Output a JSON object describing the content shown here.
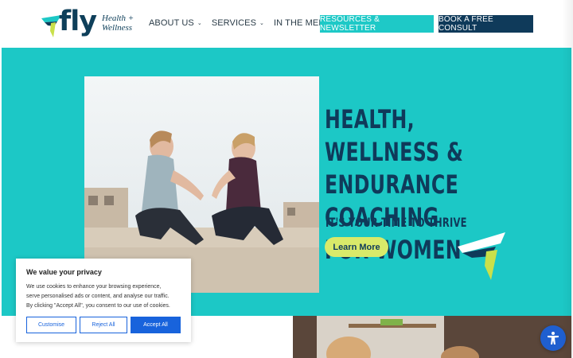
{
  "brand": {
    "name": "fly",
    "tagline_line1": "Health +",
    "tagline_line2": "Wellness"
  },
  "nav": {
    "items": [
      {
        "label": "ABOUT US",
        "has_dropdown": true
      },
      {
        "label": "SERVICES",
        "has_dropdown": true
      },
      {
        "label": "IN THE MEDIA",
        "has_dropdown": false
      }
    ],
    "resources_label": "RESOURCES & NEWSLETTER",
    "consult_label": "BOOK A FREE CONSULT"
  },
  "hero": {
    "title_line1": "HEALTH, WELLNESS &",
    "title_line2": "ENDURANCE COACHING",
    "title_line3": "FOR WOMEN",
    "subtitle": "IT'S YOUR TIME TO THRIVE",
    "cta_label": "Learn More"
  },
  "cookie": {
    "title": "We value your privacy",
    "body_line1": "We use cookies to enhance your browsing experience,",
    "body_line2": "serve personalised ads or content, and analyse our traffic.",
    "body_line3": "By clicking \"Accept All\", you consent to our use of cookies.",
    "customise_label": "Customise",
    "reject_label": "Reject All",
    "accept_label": "Accept All"
  },
  "colors": {
    "teal": "#1cc8c6",
    "navy": "#0f3a5a",
    "lime": "#d9ea6a",
    "cookie_blue": "#1863dc"
  },
  "icons": [
    "chevron-down-icon",
    "fly-logo-mark",
    "accessibility-icon"
  ]
}
